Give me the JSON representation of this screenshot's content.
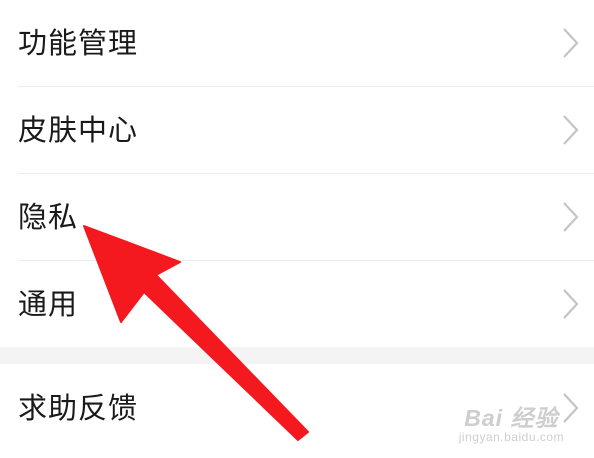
{
  "settings": {
    "items": [
      {
        "label": "功能管理",
        "icon": "chevron-right-icon"
      },
      {
        "label": "皮肤中心",
        "icon": "chevron-right-icon"
      },
      {
        "label": "隐私",
        "icon": "chevron-right-icon"
      },
      {
        "label": "通用",
        "icon": "chevron-right-icon"
      }
    ],
    "section2": [
      {
        "label": "求助反馈",
        "icon": "chevron-right-icon"
      }
    ]
  },
  "annotation": {
    "arrow_color": "#f4181f",
    "points_to": "隐私"
  },
  "watermark": {
    "logo": "Bai 经验",
    "url": "jingyan.baidu.com"
  },
  "colors": {
    "text": "#1a1a1a",
    "chevron": "#c4c4c4",
    "divider": "#ececec",
    "section_gap": "#f4f4f4"
  }
}
